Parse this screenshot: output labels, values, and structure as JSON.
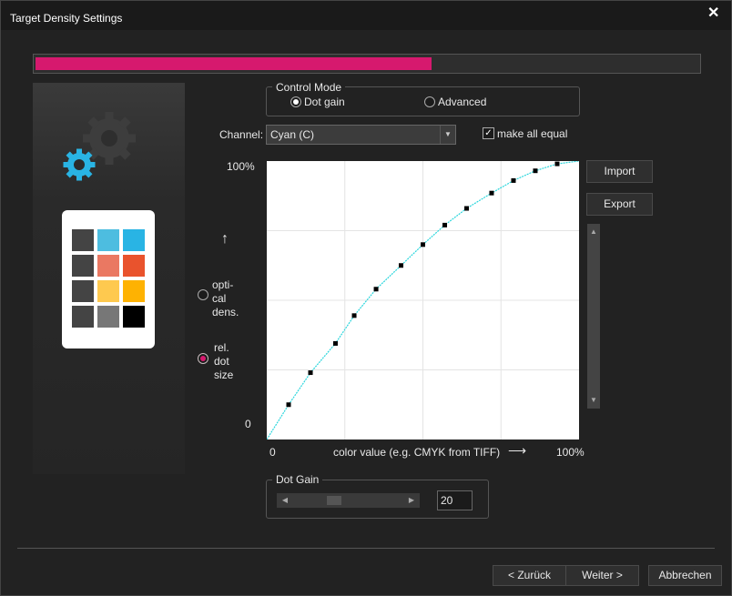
{
  "window": {
    "title": "Target Density Settings",
    "close_glyph": "✕"
  },
  "progress": {
    "fraction": 0.597,
    "color": "#d6196e"
  },
  "control_mode": {
    "legend": "Control Mode",
    "options": [
      {
        "label": "Dot gain",
        "selected": true
      },
      {
        "label": "Advanced",
        "selected": false
      }
    ]
  },
  "channel": {
    "label": "Channel:",
    "value": "Cyan (C)"
  },
  "make_all_equal": {
    "label": "make all equal",
    "checked": true,
    "glyph": "✓"
  },
  "buttons": {
    "import": "Import",
    "export": "Export",
    "back": "< Zurück",
    "next": "Weiter >",
    "cancel": "Abbrechen"
  },
  "y_axis_mode": [
    {
      "label": "opti-\ncal\ndens.",
      "selected": false
    },
    {
      "label": "rel.\ndot\nsize",
      "selected": true
    }
  ],
  "axis": {
    "y_top": "100%",
    "y_bottom": "0",
    "y_arrow": "↑",
    "x_left": "0",
    "x_right": "100%",
    "x_label": "color value (e.g. CMYK from TIFF)",
    "x_arrow": "⟶"
  },
  "dot_gain": {
    "legend": "Dot Gain",
    "value": "20",
    "slider_fraction": 0.35
  },
  "scroll": {
    "up": "▲",
    "down": "▼",
    "left": "◀",
    "right": "▶"
  },
  "palette": {
    "colors": [
      "#444444",
      "#4dbde0",
      "#29b4e4",
      "#444444",
      "#ea7862",
      "#e9532d",
      "#444444",
      "#fec94f",
      "#feb202",
      "#444444",
      "#777777",
      "#000000"
    ]
  },
  "chart_data": {
    "type": "line",
    "x": [
      0,
      7,
      14,
      22,
      28,
      35,
      43,
      50,
      57,
      64,
      72,
      79,
      86,
      93,
      100
    ],
    "series": [
      {
        "values": [
          0,
          12.5,
          24,
          34.5,
          44.5,
          54,
          62.5,
          70,
          77,
          83,
          88.5,
          93,
          96.5,
          99,
          100
        ],
        "color": "#29d6dc"
      }
    ],
    "markers": [
      [
        7,
        12.5
      ],
      [
        14,
        24
      ],
      [
        22,
        34.5
      ],
      [
        28,
        44.5
      ],
      [
        35,
        54
      ],
      [
        43,
        62.5
      ],
      [
        50,
        70
      ],
      [
        57,
        77
      ],
      [
        64,
        83
      ],
      [
        72,
        88.5
      ],
      [
        79,
        93
      ],
      [
        86,
        96.5
      ],
      [
        93,
        99
      ]
    ],
    "xlim": [
      0,
      100
    ],
    "ylim": [
      0,
      100
    ],
    "grid": true
  },
  "colors": {
    "accent": "#d6196e",
    "curve": "#29d6dc",
    "icon_blue": "#29b4e4"
  }
}
